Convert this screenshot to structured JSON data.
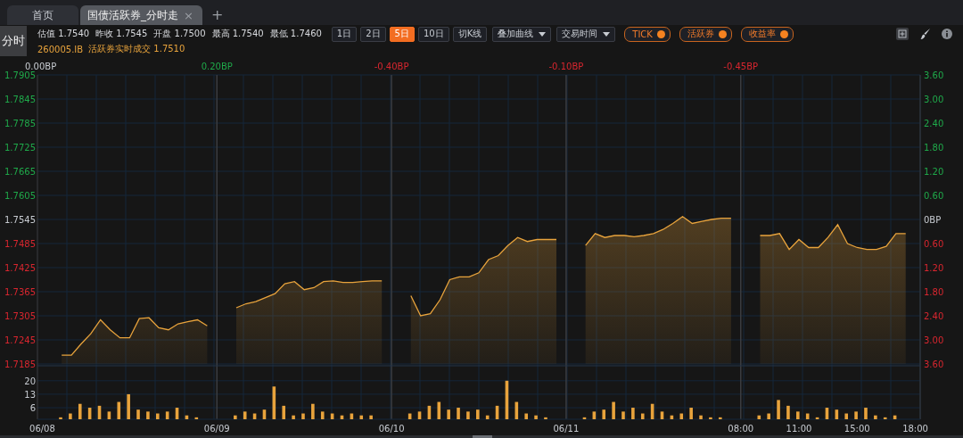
{
  "tabs": [
    {
      "label": "首页",
      "selected": false
    },
    {
      "label": "国债活跃券_分时走",
      "selected": true,
      "close": "×"
    }
  ],
  "add_tab": "+",
  "toolbar": {
    "mode_label": "分时",
    "quote": [
      {
        "label": "估值",
        "value": "1.7540"
      },
      {
        "label": "昨收",
        "value": "1.7545"
      },
      {
        "label": "开盘",
        "value": "1.7500"
      },
      {
        "label": "最高",
        "value": "1.7540"
      },
      {
        "label": "最低",
        "value": "1.7460"
      }
    ],
    "periods": [
      {
        "label": "1日",
        "selected": false
      },
      {
        "label": "2日",
        "selected": false
      },
      {
        "label": "5日",
        "selected": true
      },
      {
        "label": "10日",
        "selected": false
      }
    ],
    "kline_button": "切K线",
    "dropdowns": [
      "叠加曲线",
      "交易时间"
    ],
    "toggles": [
      {
        "label": "TICK",
        "on": true
      },
      {
        "label": "活跃券",
        "on": true
      },
      {
        "label": "收益率",
        "on": true
      }
    ]
  },
  "info_line": {
    "code": "260005.IB",
    "text": "活跃券实时成交 1.7510"
  },
  "price_chart": {
    "day_changes": [
      {
        "text": "0.00BP",
        "color": "#c8ccd2"
      },
      {
        "text": "0.20BP",
        "color": "#1fa94a"
      },
      {
        "text": "-0.40BP",
        "color": "#d9262f"
      },
      {
        "text": "-0.10BP",
        "color": "#d9262f"
      },
      {
        "text": "-0.45BP",
        "color": "#d9262f"
      }
    ],
    "right_axis_labels": [
      "3.60",
      "3.00",
      "2.40",
      "1.80",
      "1.20",
      "0.60",
      "0BP",
      "0.60",
      "1.20",
      "1.80",
      "2.40",
      "3.00",
      "3.60"
    ],
    "chart_data": {
      "type": "area",
      "ylim": [
        1.7185,
        1.7905
      ],
      "grid": true,
      "yticks": [
        1.7905,
        1.7845,
        1.7785,
        1.7725,
        1.7665,
        1.7605,
        1.7545,
        1.7485,
        1.7425,
        1.7365,
        1.7305,
        1.7245,
        1.7185
      ],
      "categories": [
        null,
        null,
        null,
        null,
        null,
        null,
        null,
        null,
        null,
        null,
        null,
        null,
        null,
        null,
        null,
        null,
        null,
        null,
        null,
        null,
        null,
        null,
        null,
        null,
        null,
        null,
        null,
        null,
        null,
        null,
        null,
        null,
        null,
        null,
        null,
        null,
        null,
        null,
        null,
        null,
        null,
        null,
        null,
        null,
        null,
        null,
        null,
        null,
        null,
        null,
        null,
        null,
        null,
        null,
        null,
        null,
        null,
        null,
        null,
        null,
        null,
        null,
        null,
        null,
        null,
        null,
        null,
        null,
        null,
        null,
        null,
        null,
        null,
        null,
        null,
        null,
        null,
        null,
        null,
        null,
        null,
        null,
        null,
        null,
        null,
        null,
        null,
        null,
        null,
        null,
        null
      ],
      "series": [
        {
          "color": "#e8a33c",
          "values": [
            null,
            null,
            1.7207,
            1.7207,
            1.7235,
            1.726,
            1.7295,
            1.727,
            1.725,
            1.725,
            1.7298,
            1.73,
            1.7275,
            1.727,
            1.7285,
            1.729,
            1.7295,
            1.728,
            null,
            null,
            1.7325,
            1.7335,
            1.734,
            1.735,
            1.736,
            1.7385,
            1.739,
            1.737,
            1.7375,
            1.739,
            1.7392,
            1.7388,
            1.7388,
            1.739,
            1.7392,
            1.7392,
            null,
            null,
            1.7355,
            1.7305,
            1.731,
            1.7345,
            1.7395,
            1.7402,
            1.7402,
            1.7412,
            1.7445,
            1.7455,
            1.748,
            1.75,
            1.749,
            1.7495,
            1.7495,
            1.7495,
            null,
            null,
            1.748,
            1.751,
            1.75,
            1.7505,
            1.7505,
            1.7502,
            1.7505,
            1.751,
            1.752,
            1.7535,
            1.7552,
            1.7535,
            1.754,
            1.7545,
            1.7548,
            1.7548,
            null,
            null,
            1.7505,
            1.7505,
            1.751,
            1.747,
            1.7495,
            1.7475,
            1.7475,
            1.75,
            1.7532,
            1.7485,
            1.7475,
            1.747,
            1.747,
            1.7478,
            1.751,
            1.751,
            null
          ]
        }
      ]
    }
  },
  "volume_chart": {
    "chart_data": {
      "type": "bar",
      "ylim": [
        0,
        25
      ],
      "yticks": [
        20,
        13,
        6
      ],
      "grid": true,
      "categories": [
        "06/08",
        null,
        null,
        null,
        null,
        null,
        null,
        null,
        null,
        null,
        null,
        null,
        null,
        null,
        null,
        null,
        null,
        null,
        "06/09",
        null,
        null,
        null,
        null,
        null,
        null,
        null,
        null,
        null,
        null,
        null,
        null,
        null,
        null,
        null,
        null,
        null,
        "06/10",
        null,
        null,
        null,
        null,
        null,
        null,
        null,
        null,
        null,
        null,
        null,
        null,
        null,
        null,
        null,
        null,
        null,
        "06/11",
        null,
        null,
        null,
        null,
        null,
        null,
        null,
        null,
        null,
        null,
        null,
        null,
        null,
        null,
        null,
        null,
        null,
        "08:00",
        null,
        null,
        null,
        null,
        null,
        "11:00",
        null,
        null,
        null,
        null,
        null,
        "15:00",
        null,
        null,
        null,
        null,
        null,
        "18:00"
      ],
      "series": [
        {
          "color": "#e8a33c",
          "values": [
            null,
            null,
            1,
            3,
            8,
            6,
            7,
            4,
            9,
            13,
            5,
            4,
            3,
            4,
            6,
            2,
            1,
            null,
            null,
            null,
            2,
            4,
            3,
            5,
            17,
            7,
            2,
            3,
            8,
            4,
            3,
            2,
            3,
            2,
            2,
            null,
            null,
            null,
            3,
            4,
            7,
            9,
            5,
            6,
            4,
            5,
            2,
            7,
            20,
            9,
            3,
            2,
            1,
            null,
            null,
            null,
            1,
            4,
            5,
            9,
            4,
            6,
            3,
            8,
            4,
            2,
            3,
            6,
            2,
            1,
            1,
            null,
            null,
            null,
            2,
            3,
            10,
            7,
            4,
            3,
            1,
            6,
            5,
            3,
            4,
            6,
            2,
            1,
            2,
            null,
            null
          ]
        }
      ]
    }
  }
}
